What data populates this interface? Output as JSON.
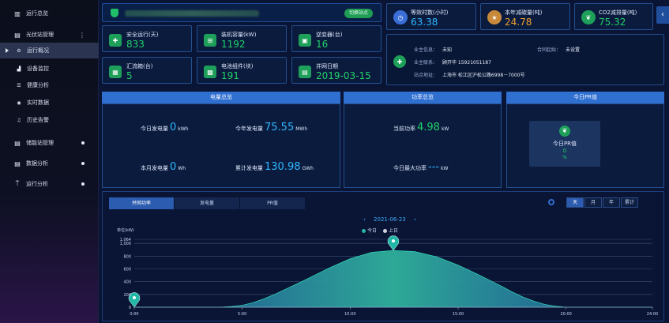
{
  "sidebar": {
    "items": [
      {
        "label": "运行总览",
        "icon": "building-icon"
      },
      {
        "label": "光伏站管理",
        "icon": "clipboard-icon"
      },
      {
        "label": "运行概况",
        "icon": "gear-icon"
      },
      {
        "label": "设备监控",
        "icon": "bar-chart-icon"
      },
      {
        "label": "健康分析",
        "icon": "list-icon"
      },
      {
        "label": "实时数据",
        "icon": "database-icon"
      },
      {
        "label": "历史告警",
        "icon": "bell-icon"
      },
      {
        "label": "储能站管理",
        "icon": "clipboard-icon"
      },
      {
        "label": "数据分析",
        "icon": "clipboard-icon"
      },
      {
        "label": "运行分析",
        "icon": "antenna-icon"
      }
    ]
  },
  "site_bar": {
    "switch_label": "切换站点"
  },
  "kpis": {
    "safe_days": {
      "label": "安全运行(天)",
      "value": "833"
    },
    "capacity": {
      "label": "装机容量(kW)",
      "value": "1192"
    },
    "inverters": {
      "label": "逆变器(台)",
      "value": "16"
    },
    "combiners": {
      "label": "汇流箱(台)",
      "value": "5"
    },
    "panels": {
      "label": "电池组件(块)",
      "value": "191"
    },
    "grid_date": {
      "label": "并网日期",
      "value": "2019-03-15"
    },
    "equiv_hours": {
      "label": "等效时数(小时)",
      "value": "63.38"
    },
    "coal_saved": {
      "label": "本年减碳量(吨)",
      "value": "24.78"
    },
    "co2_reduced": {
      "label": "CO2减排量(吨)",
      "value": "75.32"
    }
  },
  "owner": {
    "info_label": "业主信息：",
    "info_value": "未知",
    "date_label": "合同起始：",
    "date_value": "未设置",
    "contact_label": "业主联系：",
    "contact_value": "顾开华 15921051187",
    "address_label": "站点地址：",
    "address_value": "上海市 松江区沪松公路6998－7000号"
  },
  "energy": {
    "title": "电量总览",
    "today_label": "今日发电量",
    "today_value": "0",
    "today_unit": "kWh",
    "year_label": "今年发电量",
    "year_value": "75.55",
    "year_unit": "MWh",
    "month_label": "本月发电量",
    "month_value": "0",
    "month_unit": "Wh",
    "total_label": "累计发电量",
    "total_value": "130.98",
    "total_unit": "GWh"
  },
  "power": {
    "title": "功率总览",
    "current_label": "当前功率",
    "current_value": "4.98",
    "current_unit": "kW",
    "max_label": "今日最大功率",
    "max_value": "---",
    "max_unit": "kW"
  },
  "pr": {
    "title": "今日PR值",
    "label": "今日PR值",
    "value": "0",
    "unit": "%"
  },
  "chart_tabs": [
    "并网功率",
    "发电量",
    "PR值"
  ],
  "period_buttons": [
    "天",
    "月",
    "年",
    "累计"
  ],
  "chart_nav": {
    "date": "2021-06-23",
    "prev": "‹",
    "next": "›"
  },
  "legend": [
    {
      "name": "今日",
      "color": "#22b8a8"
    },
    {
      "name": "上日",
      "color": "#d0d4df"
    }
  ],
  "colors": {
    "accent": "#2f6fd0",
    "green": "#22d068",
    "blue": "#2fb7ff",
    "orange": "#f0a030"
  },
  "chart_data": {
    "type": "area",
    "ylabel": "单位(kW)",
    "y_ticks": [
      "0",
      "200",
      "400",
      "600",
      "800",
      "1,000",
      "1,064"
    ],
    "x_ticks": [
      "0:00",
      "5:00",
      "10:00",
      "15:00",
      "20:00",
      "24:00"
    ],
    "ylim": [
      0,
      1064
    ],
    "xlim": [
      0,
      24
    ],
    "series": [
      {
        "name": "今日",
        "x": [
          0,
          4,
          4.5,
          5,
          5.5,
          6,
          6.5,
          7,
          8,
          9,
          10,
          11,
          12,
          13,
          14,
          15,
          16,
          17,
          17.5,
          18,
          18.5,
          19,
          19.5,
          20,
          24
        ],
        "values": [
          0,
          0,
          10,
          30,
          70,
          130,
          200,
          280,
          440,
          610,
          760,
          860,
          890,
          870,
          790,
          660,
          500,
          330,
          240,
          160,
          95,
          45,
          15,
          0,
          0
        ]
      }
    ],
    "markers": [
      {
        "x": 0,
        "y": 0
      },
      {
        "x": 12,
        "y": 890
      }
    ]
  }
}
